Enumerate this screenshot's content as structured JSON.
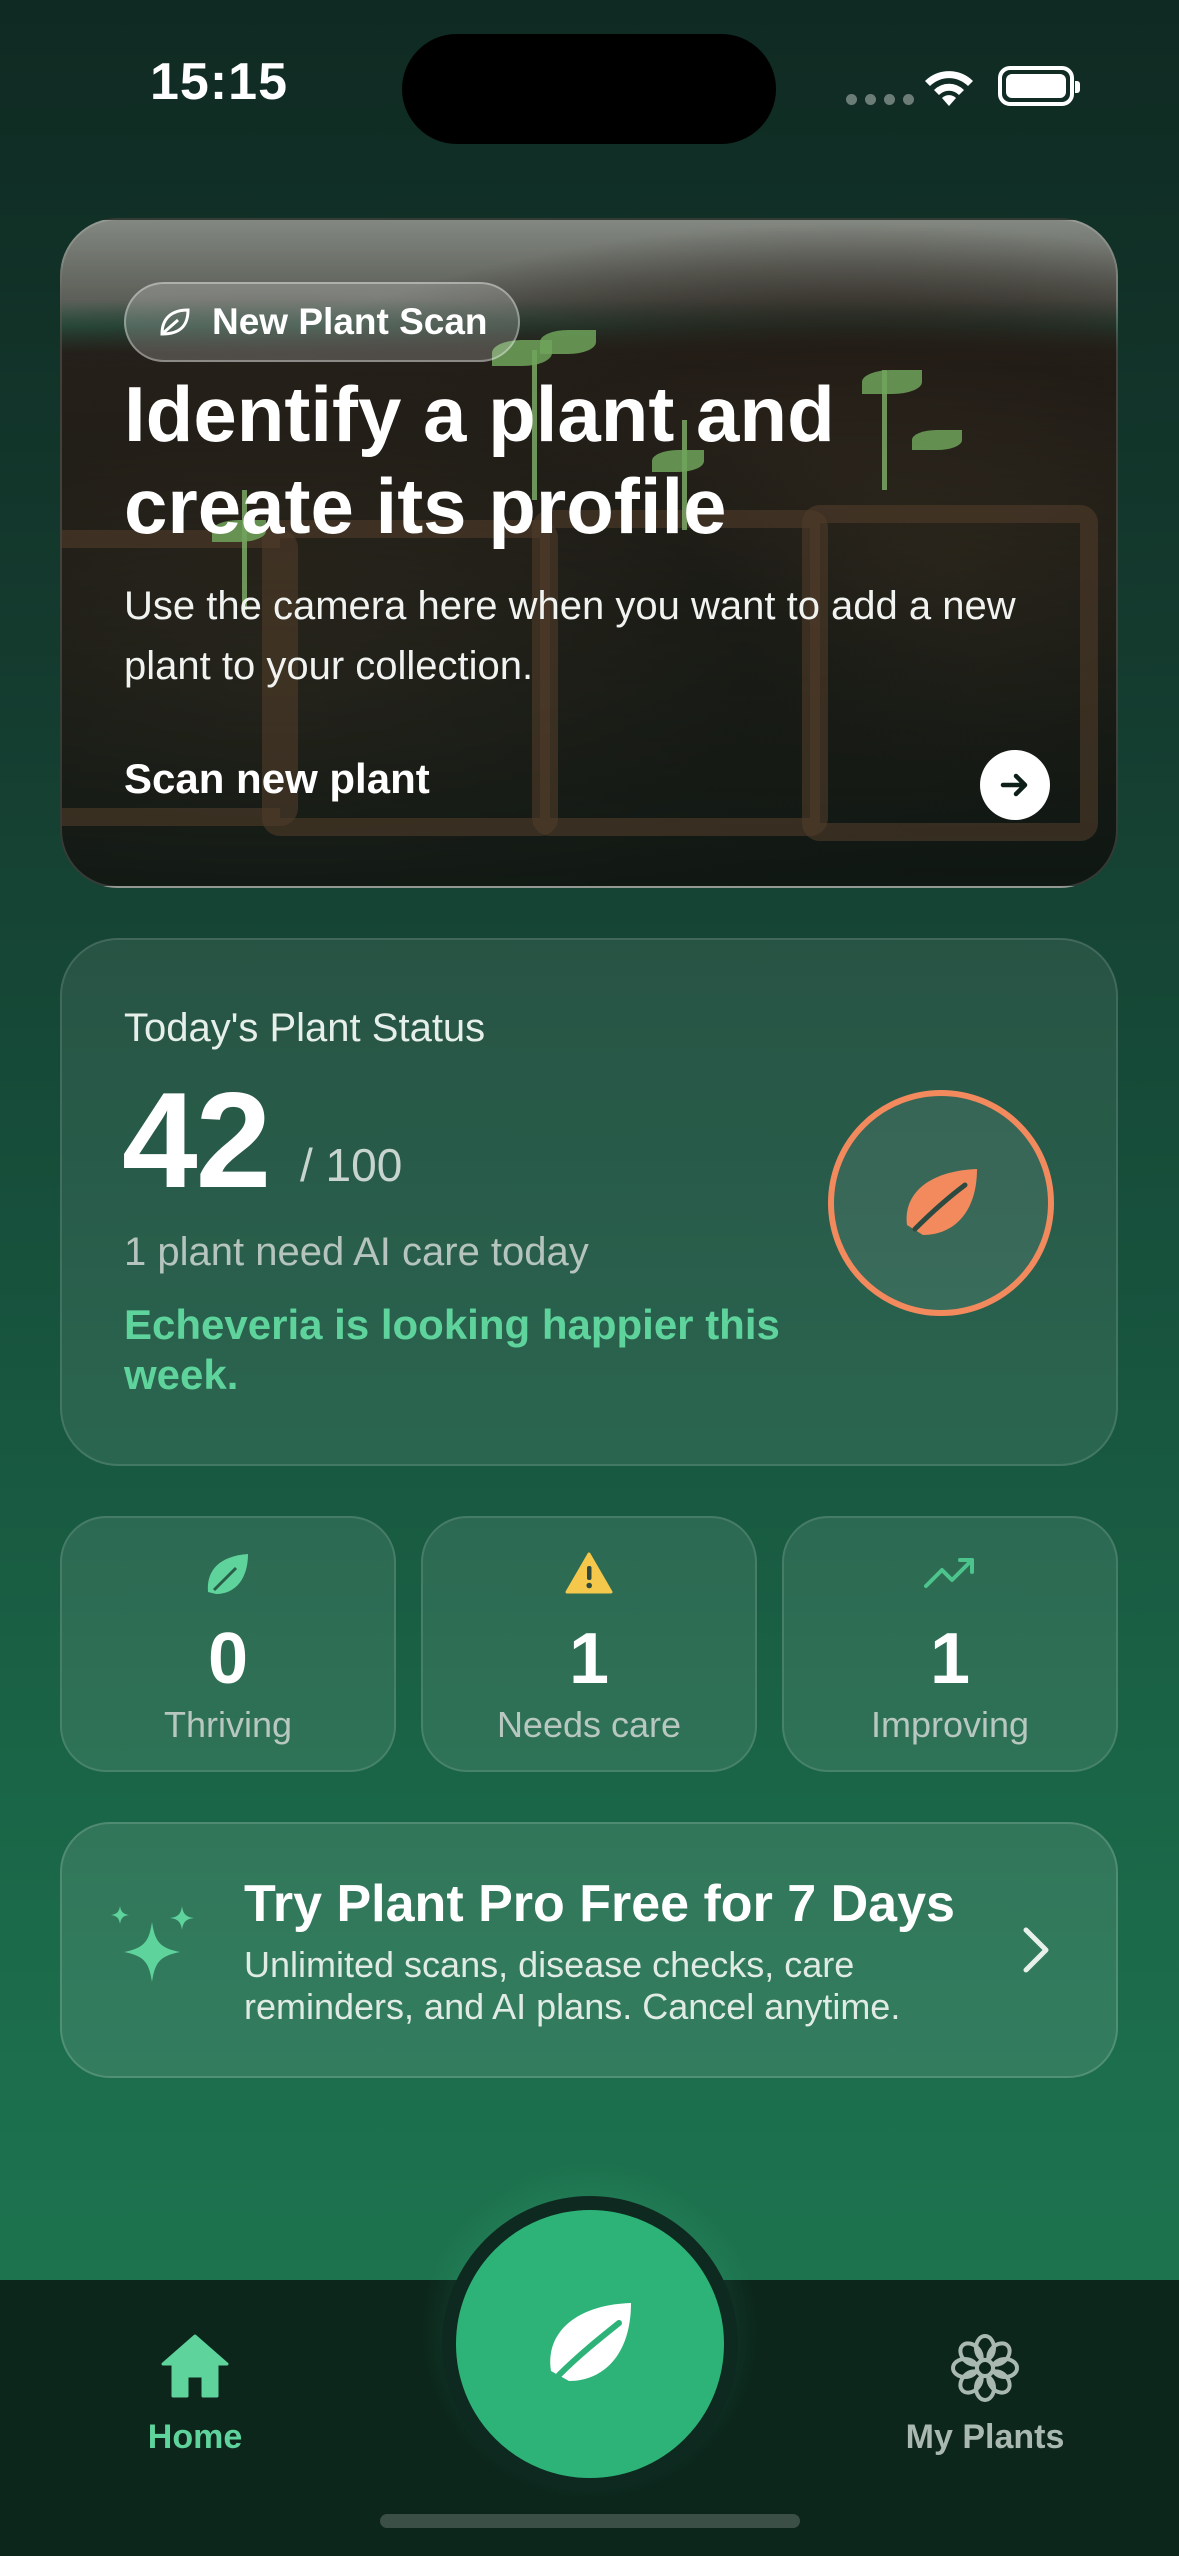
{
  "status_bar": {
    "time": "15:15"
  },
  "hero": {
    "pill_label": "New Plant Scan",
    "title": "Identify a plant and create its profile",
    "subtitle": "Use the camera here when you want to add a new plant to your collection.",
    "cta_label": "Scan new plant"
  },
  "status_card": {
    "title": "Today's Plant Status",
    "score": "42",
    "score_max": "/ 100",
    "score_value": 42,
    "need_text": "1 plant need AI care today",
    "highlight": "Echeveria is looking happier this week.",
    "accent": "#f28a5e"
  },
  "stats": [
    {
      "icon": "leaf-icon",
      "value": "0",
      "label": "Thriving"
    },
    {
      "icon": "warning-icon",
      "value": "1",
      "label": "Needs care"
    },
    {
      "icon": "trending-up-icon",
      "value": "1",
      "label": "Improving"
    }
  ],
  "promo": {
    "title": "Try Plant Pro Free for 7 Days",
    "subtitle": "Unlimited scans, disease checks, care reminders, and AI plans. Cancel anytime."
  },
  "tabbar": {
    "home_label": "Home",
    "plants_label": "My Plants",
    "active_color": "#5fd39c",
    "fab_color": "#2db378"
  }
}
